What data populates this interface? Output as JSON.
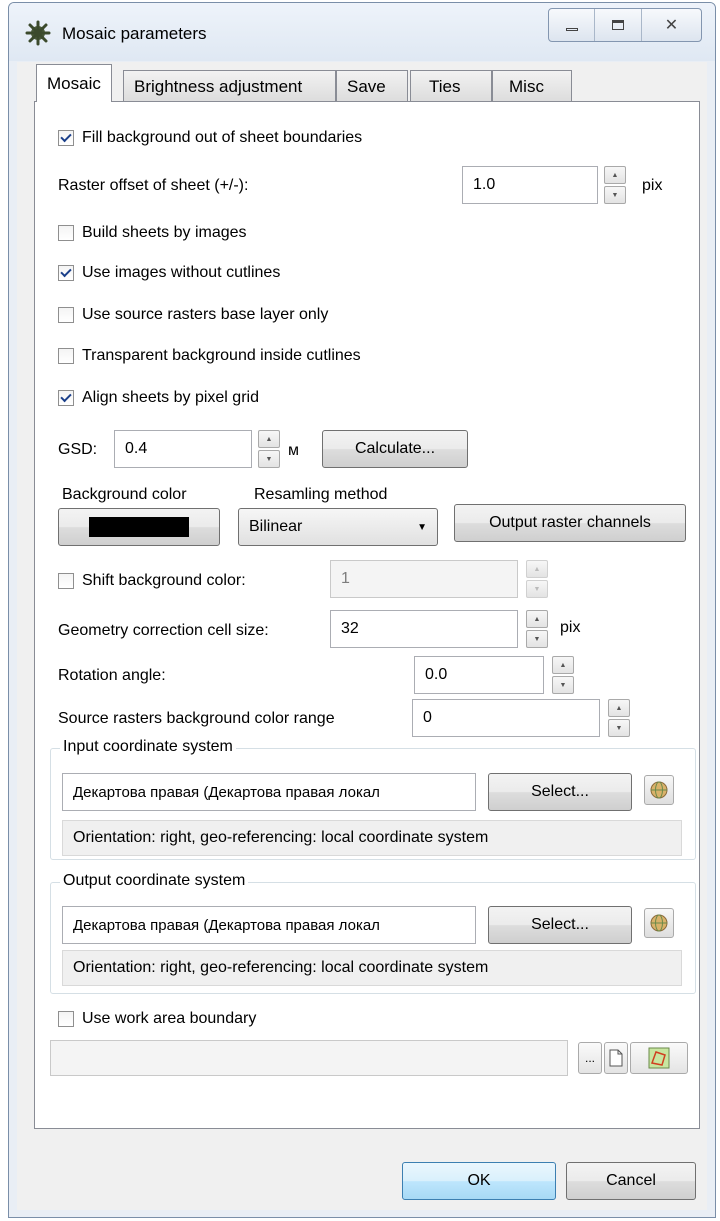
{
  "window": {
    "title": "Mosaic parameters"
  },
  "tabs": [
    {
      "label": "Mosaic"
    },
    {
      "label": "Brightness adjustment"
    },
    {
      "label": "Save"
    },
    {
      "label": "Ties"
    },
    {
      "label": "Misc"
    }
  ],
  "mosaic": {
    "fill_background": {
      "label": "Fill background out of sheet boundaries",
      "checked": true
    },
    "raster_offset": {
      "label": "Raster offset of sheet (+/-):",
      "value": "1.0",
      "unit": "pix"
    },
    "build_sheets": {
      "label": "Build sheets by images",
      "checked": false
    },
    "use_images_without_cutlines": {
      "label": "Use images without cutlines",
      "checked": true
    },
    "use_base_layer": {
      "label": "Use source rasters base layer only",
      "checked": false
    },
    "transparent_background": {
      "label": "Transparent background inside cutlines",
      "checked": false
    },
    "align_sheets": {
      "label": "Align sheets by pixel grid",
      "checked": true
    },
    "gsd": {
      "label": "GSD:",
      "value": "0.4",
      "unit": "м",
      "calculate_label": "Calculate..."
    },
    "background_color": {
      "label": "Background color",
      "color": "#000000"
    },
    "resampling": {
      "label": "Resamling method",
      "value": "Bilinear"
    },
    "output_channels_label": "Output raster channels",
    "shift_background": {
      "label": "Shift background color:",
      "checked": false,
      "value": "1"
    },
    "geometry_cell": {
      "label": "Geometry correction cell size:",
      "value": "32",
      "unit": "pix"
    },
    "rotation": {
      "label": "Rotation angle:",
      "value": "0.0"
    },
    "bg_color_range": {
      "label": "Source rasters background color range",
      "value": "0"
    },
    "input_cs": {
      "title": "Input coordinate system",
      "value": "Декартова правая (Декартова правая локал",
      "select_label": "Select...",
      "info": "Orientation: right, geo-referencing: local coordinate system"
    },
    "output_cs": {
      "title": "Output coordinate system",
      "value": "Декартова правая (Декартова правая локал",
      "select_label": "Select...",
      "info": "Orientation: right, geo-referencing: local coordinate system"
    },
    "work_area": {
      "label": "Use work area boundary",
      "checked": false,
      "browse_label": "...",
      "path": ""
    }
  },
  "footer": {
    "ok_label": "OK",
    "cancel_label": "Cancel"
  },
  "colors": {
    "accent": "#3c7fb1",
    "window_frame": "#7a8ea8"
  }
}
